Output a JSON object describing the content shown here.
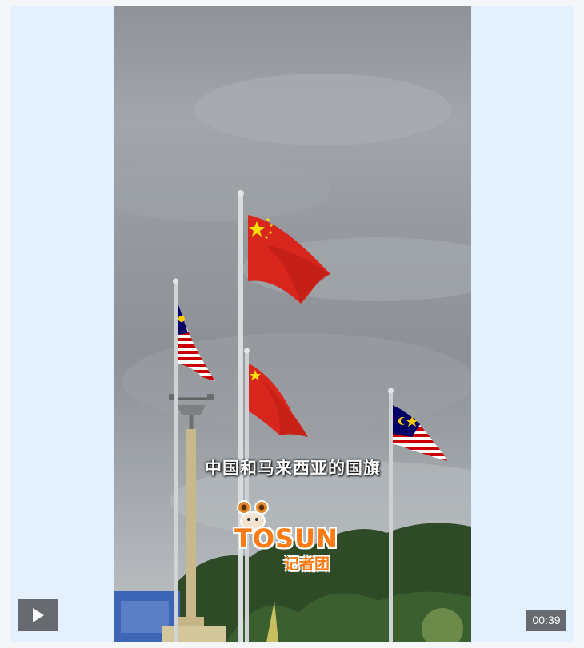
{
  "video": {
    "caption": "中国和马来西亚的国旗",
    "watermark_brand": "TOSUN",
    "watermark_sub": "记者团",
    "duration": "00:39",
    "play_icon": "play-icon",
    "colors": {
      "page_background": "#f4f6f8",
      "player_background": "#e4f0fd",
      "control_background": "#676b70",
      "china_flag_red": "#d9261c",
      "china_flag_star": "#ffde00",
      "malaysia_stripe_red": "#cc0001",
      "malaysia_canton_blue": "#010066",
      "watermark_orange": "#ff7a12"
    }
  }
}
